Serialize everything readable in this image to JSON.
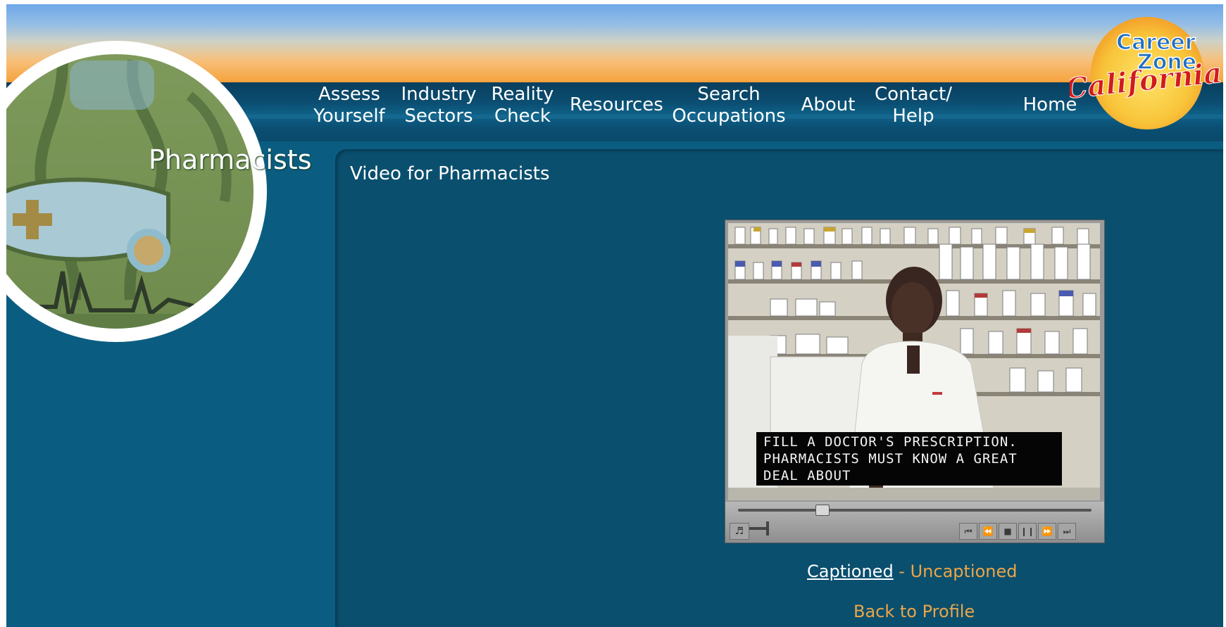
{
  "nav": {
    "items": [
      {
        "label": "Assess\nYourself"
      },
      {
        "label": "Industry\nSectors"
      },
      {
        "label": "Reality\nCheck"
      },
      {
        "label": "Resources"
      },
      {
        "label": "Search\nOccupations"
      },
      {
        "label": "About"
      },
      {
        "label": "Contact/\nHelp"
      },
      {
        "label": "Home"
      }
    ]
  },
  "logo": {
    "line1": "Career",
    "line2": "Zone",
    "script": "California",
    "icon": "career-zone-california-logo"
  },
  "sidebar": {
    "title": "Pharmacists",
    "emblem_icon": "pharmacist-emblem-icon"
  },
  "main": {
    "heading": "Video for Pharmacists",
    "video": {
      "caption": "FILL A DOCTOR'S PRESCRIPTION.\nPHARMACISTS MUST KNOW A GREAT\nDEAL ABOUT",
      "progress": 0.24,
      "volume": 0.5
    },
    "links": {
      "captioned": "Captioned",
      "separator": " - ",
      "uncaptioned": "Uncaptioned",
      "back": "Back to Profile"
    }
  },
  "colors": {
    "background": "#0a5d80",
    "panel": "#0a4f6e",
    "link_orange": "#eba547",
    "sunset_orange": "#f6a23c",
    "sky_blue": "#6fa7e8"
  }
}
